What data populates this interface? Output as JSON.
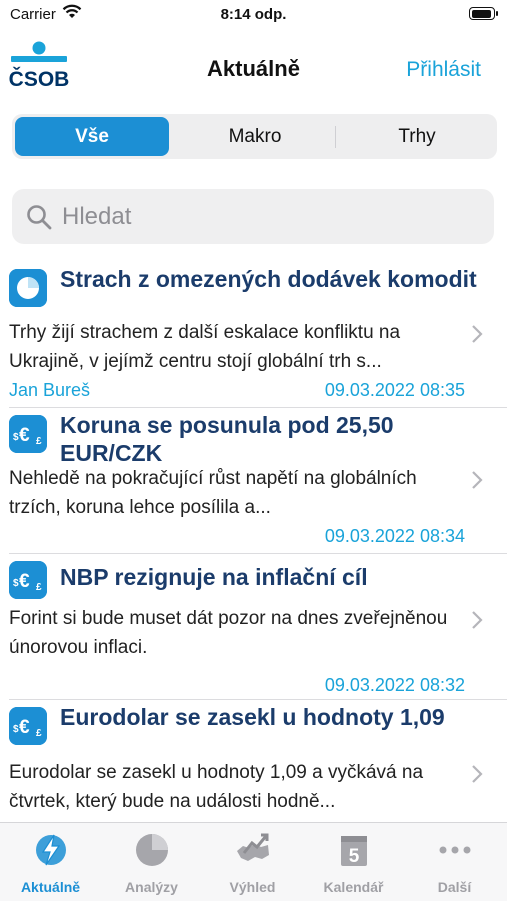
{
  "status_bar": {
    "carrier": "Carrier",
    "time": "8:14 odp."
  },
  "header": {
    "logo_text": "ČSOB",
    "title": "Aktuálně",
    "login_label": "Přihlásit"
  },
  "segments": [
    {
      "label": "Vše",
      "selected": true
    },
    {
      "label": "Makro",
      "selected": false
    },
    {
      "label": "Trhy",
      "selected": false
    }
  ],
  "search": {
    "placeholder": "Hledat",
    "value": ""
  },
  "articles": [
    {
      "icon": "pie-chart-icon",
      "title": "Strach z omezených dodávek komodit",
      "summary": "Trhy žijí strachem z další eskalace konfliktu na Ukrajině, v jejímž centru stojí globální trh s...",
      "author": "Jan Bureš",
      "date": "09.03.2022 08:35"
    },
    {
      "icon": "currency-icon",
      "title": "Koruna se posunula pod 25,50 EUR/CZK",
      "summary": "Nehledě na pokračující růst napětí na globálních trzích, koruna lehce posílila a...",
      "author": "",
      "date": "09.03.2022 08:34"
    },
    {
      "icon": "currency-icon",
      "title": "NBP rezignuje na inflační cíl",
      "summary": "Forint si bude muset dát pozor na dnes zveřejněnou únorovou inflaci.",
      "author": "",
      "date": "09.03.2022 08:32"
    },
    {
      "icon": "currency-icon",
      "title": "Eurodolar se zasekl u hodnoty 1,09",
      "summary": "Eurodolar se zasekl u hodnoty 1,09 a vyčkává na čtvrtek, který bude na události hodně...",
      "author": "",
      "date": ""
    }
  ],
  "tabs": [
    {
      "label": "Aktuálně",
      "icon": "news-bolt-icon",
      "active": true
    },
    {
      "label": "Analýzy",
      "icon": "pie-chart-icon",
      "active": false
    },
    {
      "label": "Výhled",
      "icon": "map-outlook-icon",
      "active": false
    },
    {
      "label": "Kalendář",
      "icon": "calendar-icon",
      "active": false,
      "badge": "5"
    },
    {
      "label": "Další",
      "icon": "more-icon",
      "active": false
    }
  ],
  "colors": {
    "accent": "#1c8fd4",
    "link": "#1aa3d9",
    "title": "#1b3c6b",
    "brand_navy": "#003366"
  }
}
